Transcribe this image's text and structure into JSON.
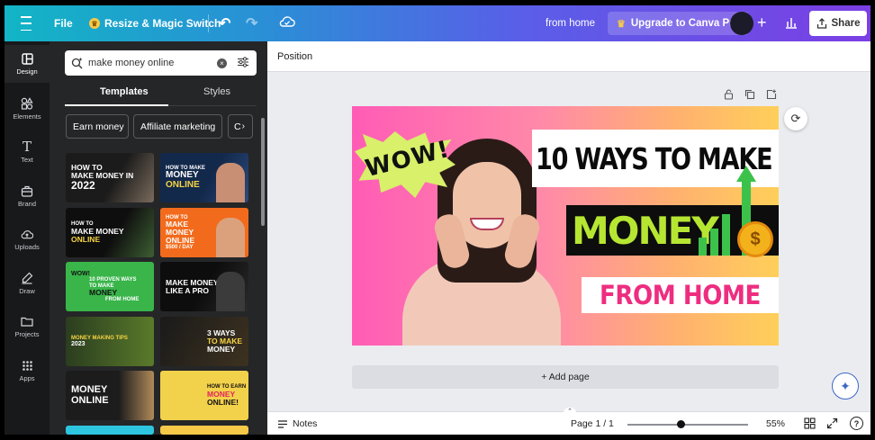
{
  "topbar": {
    "file_label": "File",
    "resize_label": "Resize & Magic Switch",
    "doc_title": "from home",
    "upgrade_label": "Upgrade to Canva Pro",
    "share_label": "Share",
    "brand_gradient_start": "#12b5c5",
    "brand_gradient_end": "#7b3fe4"
  },
  "leftnav": {
    "items": [
      {
        "label": "Design",
        "icon": "layout-icon"
      },
      {
        "label": "Elements",
        "icon": "shapes-icon"
      },
      {
        "label": "Text",
        "icon": "text-icon"
      },
      {
        "label": "Brand",
        "icon": "brand-icon"
      },
      {
        "label": "Uploads",
        "icon": "upload-icon"
      },
      {
        "label": "Draw",
        "icon": "pen-icon"
      },
      {
        "label": "Projects",
        "icon": "folder-icon"
      },
      {
        "label": "Apps",
        "icon": "grid-icon"
      }
    ]
  },
  "panel": {
    "search_value": "make money online",
    "tabs": [
      "Templates",
      "Styles"
    ],
    "chips": [
      "Earn money",
      "Affiliate marketing",
      "C"
    ],
    "thumbnails": [
      {
        "lines": [
          "HOW TO",
          "MAKE MONEY IN",
          "2022"
        ]
      },
      {
        "lines": [
          "HOW TO MAKE",
          "MONEY",
          "ONLINE"
        ]
      },
      {
        "lines": [
          "HOW TO",
          "MAKE MONEY",
          "ONLINE"
        ]
      },
      {
        "lines": [
          "HOW TO",
          "MAKE",
          "MONEY",
          "ONLINE",
          "$500 / DAY"
        ]
      },
      {
        "lines": [
          "WOW!",
          "10 PROVEN WAYS",
          "TO MAKE",
          "MONEY",
          "FROM HOME"
        ]
      },
      {
        "lines": [
          "MAKE MONEY",
          "LIKE A PRO"
        ]
      },
      {
        "lines": [
          "MONEY MAKING TIPS",
          "2023"
        ]
      },
      {
        "lines": [
          "3 WAYS",
          "TO MAKE",
          "MONEY"
        ]
      },
      {
        "lines": [
          "MONEY",
          "ONLINE"
        ]
      },
      {
        "lines": [
          "HOW TO EARN",
          "MONEY",
          "ONLINE!"
        ]
      }
    ]
  },
  "workspace": {
    "context_label": "Position",
    "design": {
      "burst_text": "WOW!",
      "title_line": "10 WAYS TO MAKE",
      "money_line": "MONEY",
      "home_line": "FROM HOME",
      "coin_symbol": "$"
    },
    "add_page_label": "+ Add page"
  },
  "footer": {
    "notes_label": "Notes",
    "page_label": "Page 1 / 1",
    "zoom_label": "55%",
    "help_label": "?"
  }
}
